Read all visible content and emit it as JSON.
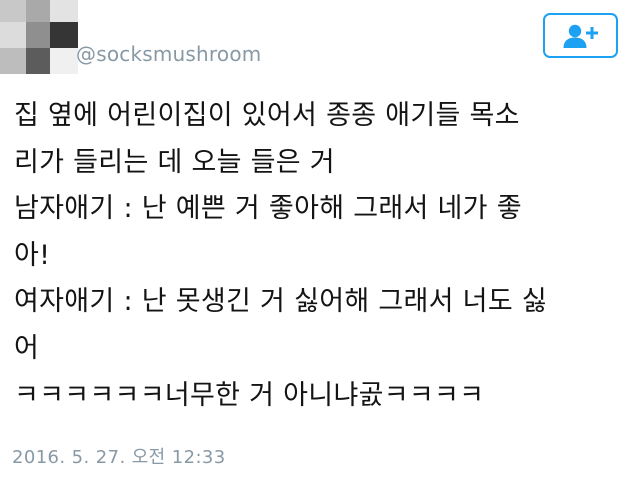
{
  "author": {
    "handle": "@socksmushroom"
  },
  "actions": {
    "follow_icon": "follow-user-plus-icon",
    "accent_color": "#1da1f2"
  },
  "tweet": {
    "lines": [
      "집 옆에 어린이집이 있어서 종종 애기들 목소",
      "리가 들리는 데 오늘 들은 거",
      "남자애기 : 난 예쁜 거 좋아해 그래서 네가 좋",
      "아!",
      "여자애기 : 난 못생긴 거 싫어해 그래서 너도 싫",
      "어",
      "ㅋㅋㅋㅋㅋㅋ너무한 거 아니냐곬ㅋㅋㅋㅋ"
    ],
    "timestamp": "2016. 5. 27. 오전 12:33"
  },
  "colors": {
    "handle": "#8899a6",
    "text": "#141414",
    "timestamp": "#8899a6"
  }
}
